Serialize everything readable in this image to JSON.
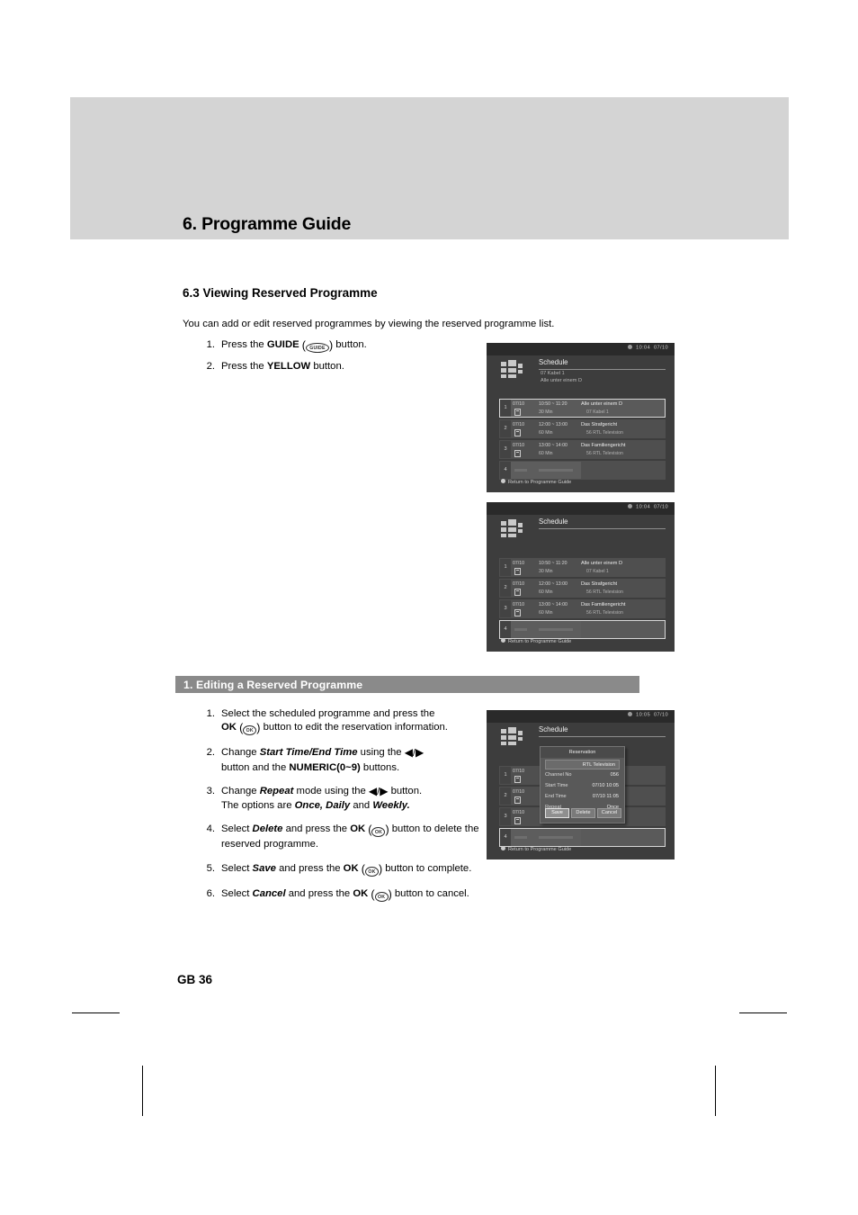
{
  "page": {
    "chapter_title": "6. Programme Guide",
    "page_number": "GB 36"
  },
  "section": {
    "heading": "6.3 Viewing Reserved Programme",
    "intro": "You can add or edit reserved programmes by viewing the reserved programme list.",
    "steps": [
      {
        "num": "1.",
        "pre": "Press the ",
        "bold": "GUIDE",
        "glyph": "GUIDE",
        "post": " button."
      },
      {
        "num": "2.",
        "pre": "Press the ",
        "bold": "YELLOW",
        "glyph": "",
        "post": " button."
      }
    ]
  },
  "subsection": {
    "bar_label": "1. Editing a Reserved Programme",
    "steps": {
      "s1_a": "Select the scheduled programme and press the",
      "s1_ok": "OK",
      "s1_b": " button to edit the reservation information.",
      "s2_a": "Change ",
      "s2_em": "Start Time/End Time",
      "s2_b": " using the ",
      "s2_c": " button and the ",
      "s2_bold": "NUMERIC(0~9)",
      "s2_d": " buttons.",
      "s3_a": "Change ",
      "s3_em": "Repeat",
      "s3_b": " mode using the ",
      "s3_c": " button.",
      "s3_d": "The options are ",
      "s3_em2": "Once, Daily",
      "s3_e": " and ",
      "s3_em3": "Weekly.",
      "s4_a": "Select ",
      "s4_em": "Delete",
      "s4_b": " and press the ",
      "s4_ok": "OK",
      "s4_c": " button to delete the reserved programme.",
      "s5_a": "Select ",
      "s5_em": "Save",
      "s5_b": " and press the ",
      "s5_ok": "OK",
      "s5_c": " button to complete.",
      "s6_a": "Select ",
      "s6_em": "Cancel",
      "s6_b": " and press the ",
      "s6_ok": "OK",
      "s6_c": " button to cancel."
    },
    "step_nums": [
      "1.",
      "2.",
      "3.",
      "4.",
      "5.",
      "6."
    ]
  },
  "glyphs": {
    "ok_label": "OK",
    "guide_label": "GUIDE",
    "left_arrow": "◀",
    "right_arrow": "▶",
    "slash": "/"
  },
  "tv_screens": [
    {
      "id": "schedule-list-row1-selected",
      "clock": "10:04",
      "date": "07/10",
      "title": "Schedule",
      "sub1": "07  Kabel 1",
      "sub2": "Alle unter einem D",
      "footer": "Return to Programme Guide",
      "selected_index": 0,
      "rows": [
        {
          "idx": "1",
          "date": "07/10",
          "time": "10:50 ~ 11:20",
          "duration": "30 Min",
          "name": "Alle unter einem D",
          "channel": "07  Kabel 1",
          "empty": false
        },
        {
          "idx": "2",
          "date": "07/10",
          "time": "12:00 ~ 13:00",
          "duration": "60 Min",
          "name": "Das Strafgericht",
          "channel": "56  RTL Television",
          "empty": false
        },
        {
          "idx": "3",
          "date": "07/10",
          "time": "13:00 ~ 14:00",
          "duration": "60 Min",
          "name": "Das Familiengericht",
          "channel": "56  RTL Television",
          "empty": false
        },
        {
          "idx": "4",
          "date": "",
          "time": "",
          "duration": "",
          "name": "",
          "channel": "",
          "empty": true
        }
      ]
    },
    {
      "id": "schedule-list-row4-selected",
      "clock": "10:04",
      "date": "07/10",
      "title": "Schedule",
      "sub1": "",
      "sub2": "",
      "footer": "Return to Programme Guide",
      "selected_index": 3,
      "rows": [
        {
          "idx": "1",
          "date": "07/10",
          "time": "10:50 ~ 11:20",
          "duration": "30 Min",
          "name": "Alle unter einem D",
          "channel": "07  Kabel 1",
          "empty": false
        },
        {
          "idx": "2",
          "date": "07/10",
          "time": "12:00 ~ 13:00",
          "duration": "60 Min",
          "name": "Das Strafgericht",
          "channel": "56  RTL Television",
          "empty": false
        },
        {
          "idx": "3",
          "date": "07/10",
          "time": "13:00 ~ 14:00",
          "duration": "60 Min",
          "name": "Das Familiengericht",
          "channel": "56  RTL Television",
          "empty": false
        },
        {
          "idx": "4",
          "date": "",
          "time": "",
          "duration": "",
          "name": "",
          "channel": "",
          "empty": true
        }
      ]
    },
    {
      "id": "schedule-reservation-dialog",
      "clock": "10:05",
      "date": "07/10",
      "title": "Schedule",
      "sub1": "",
      "sub2": "",
      "footer": "Return to Programme Guide",
      "selected_index": 3,
      "rows": [
        {
          "idx": "1",
          "date": "07/10",
          "time": "",
          "duration": "",
          "name": "",
          "channel": "",
          "empty": false
        },
        {
          "idx": "2",
          "date": "07/10",
          "time": "",
          "duration": "",
          "name": "",
          "channel": "",
          "empty": false
        },
        {
          "idx": "3",
          "date": "07/10",
          "time": "",
          "duration": "",
          "name": "",
          "channel": "",
          "empty": false
        },
        {
          "idx": "4",
          "date": "",
          "time": "",
          "duration": "",
          "name": "",
          "channel": "",
          "empty": true
        }
      ],
      "dialog": {
        "title": "Reservation",
        "channel_name": "RTL Television",
        "fields": [
          {
            "key": "Channel No",
            "value": "056"
          },
          {
            "key": "Start Time",
            "value": "07/10  10:05"
          },
          {
            "key": "End Time",
            "value": "07/10  11:05"
          },
          {
            "key": "Repeat",
            "value": "Once"
          }
        ],
        "buttons": [
          {
            "label": "Save",
            "active": true
          },
          {
            "label": "Delete",
            "active": false
          },
          {
            "label": "Cancel",
            "active": false
          }
        ]
      }
    }
  ],
  "colors": {
    "header_band": "#d4d4d4",
    "subsection_bar": "#8a8a8a",
    "tv_background": "#3d3d3d",
    "tv_row": "#4f4f4f",
    "text": "#000000"
  }
}
